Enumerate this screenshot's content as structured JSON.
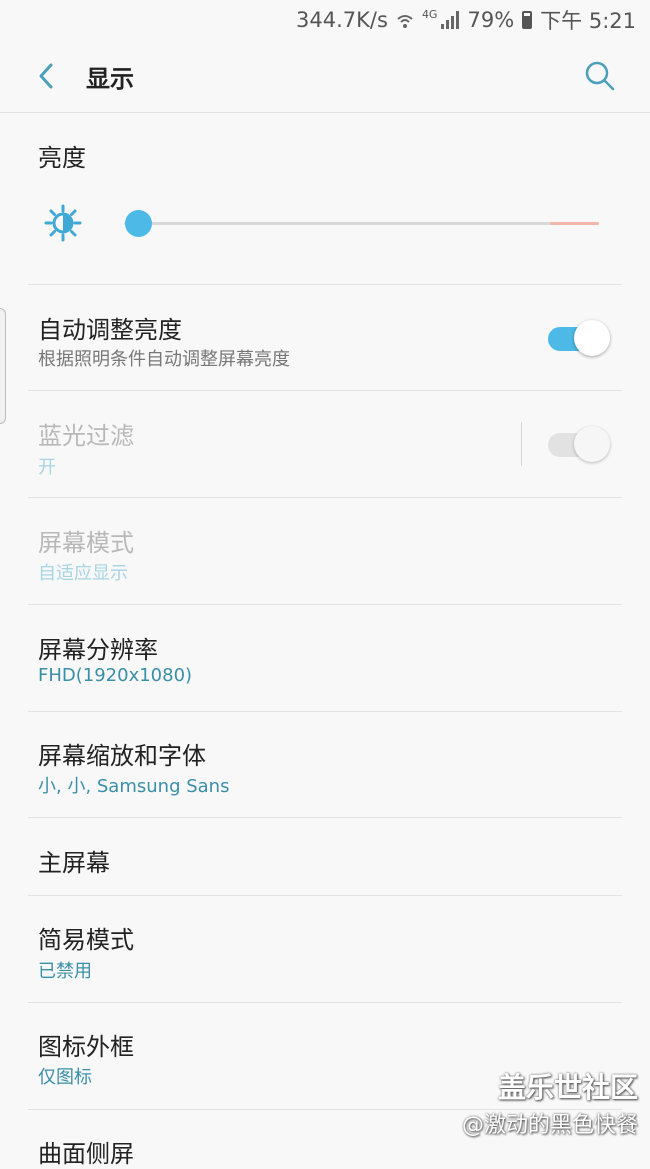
{
  "status_bar": {
    "speed": "344.7K/s",
    "network": "4G",
    "battery": "79%",
    "time": "下午 5:21"
  },
  "header": {
    "title": "显示",
    "back_icon": "chevron-left-icon",
    "search_icon": "search-icon"
  },
  "brightness": {
    "section_title": "亮度",
    "level": 0.03,
    "accent": "#4db9e6"
  },
  "settings": [
    {
      "label": "自动调整亮度",
      "sub": "根据照明条件自动调整屏幕亮度",
      "toggle": true,
      "enabled": true
    },
    {
      "label": "蓝光过滤",
      "sub": "开",
      "toggle": true,
      "enabled": false
    },
    {
      "label": "屏幕模式",
      "sub": "自适应显示",
      "enabled": false
    },
    {
      "label": "屏幕分辨率",
      "sub": "FHD(1920x1080)",
      "enabled": true
    },
    {
      "label": "屏幕缩放和字体",
      "sub": "小, 小, Samsung Sans",
      "enabled": true
    },
    {
      "label": "主屏幕",
      "enabled": true
    },
    {
      "label": "简易模式",
      "sub": "已禁用",
      "enabled": true
    },
    {
      "label": "图标外框",
      "sub": "仅图标",
      "enabled": true
    },
    {
      "label": "曲面侧屏",
      "enabled": true
    }
  ],
  "watermark": {
    "line1": "盖乐世社区",
    "line2": "@激动的黑色快餐"
  }
}
